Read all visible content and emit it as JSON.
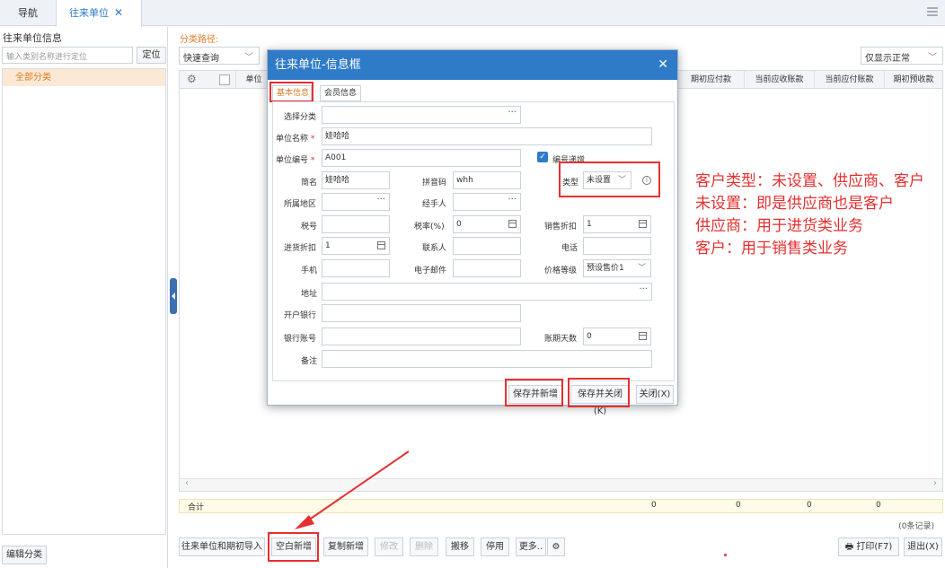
{
  "tabs": {
    "nav": "导航",
    "active": "往来单位"
  },
  "left": {
    "title": "往来单位信息",
    "search_placeholder": "输入类别名称进行定位",
    "locate": "定位",
    "tree_item": "全部分类",
    "edit_class": "编辑分类"
  },
  "main": {
    "path_label": "分类路径:",
    "quick": "快速查询",
    "filter": "仅显示正常",
    "columns": [
      "单位",
      "期初应付款",
      "当前应收账款",
      "当前应付账款",
      "期初预收款"
    ],
    "total_label": "合计",
    "totals": [
      "0",
      "0",
      "0",
      "0"
    ],
    "records": "(0条记录)"
  },
  "toolbar": {
    "import": "往来单位和期初导入",
    "new_blank": "空白新增",
    "copy_new": "复制新增",
    "edit": "修改",
    "delete": "删除",
    "move": "搬移",
    "disable": "停用",
    "more": "更多..",
    "print": "打印(F7)",
    "exit": "退出(X)"
  },
  "dialog": {
    "title": "往来单位-信息框",
    "tab_basic": "基本信息",
    "tab_member": "会员信息",
    "labels": {
      "category": "选择分类",
      "name": "单位名称",
      "code": "单位编号",
      "auto_code": "编号递增",
      "short": "简名",
      "pinyin": "拼音码",
      "type": "类型",
      "region": "所属地区",
      "handler": "经手人",
      "tax_no": "税号",
      "tax_rate": "税率(%)",
      "sale_discount": "销售折扣",
      "purchase_discount": "进货折扣",
      "contact": "联系人",
      "phone": "电话",
      "mobile": "手机",
      "email": "电子邮件",
      "price_level": "价格等级",
      "address": "地址",
      "bank": "开户银行",
      "account": "银行账号",
      "term_days": "账期天数",
      "remark": "备注"
    },
    "values": {
      "name": "娃哈哈",
      "code": "A001",
      "short": "娃哈哈",
      "pinyin": "whh",
      "type": "未设置",
      "tax_rate": "0",
      "sale_discount": "1",
      "purchase_discount": "1",
      "price_level": "预设售价1",
      "term_days": "0"
    },
    "buttons": {
      "save_new": "保存并新增",
      "save_close": "保存并关闭(K)",
      "close": "关闭(X)"
    }
  },
  "annotation": [
    "客户类型：未设置、供应商、客户",
    "未设置：即是供应商也是客户",
    "供应商：用于进货类业务",
    "客户：用于销售类业务"
  ],
  "colors": {
    "accent": "#2f7bc7",
    "highlight": "#e53030",
    "tree_selected": "#fbe9d6"
  }
}
